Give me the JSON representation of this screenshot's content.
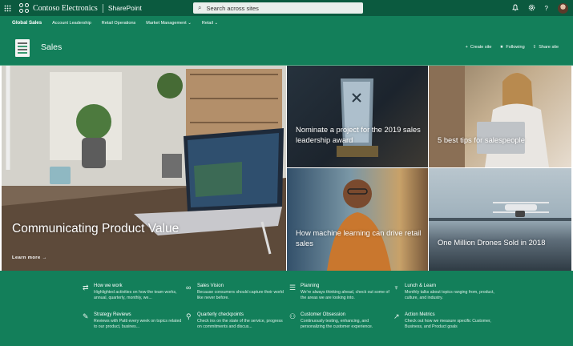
{
  "suite": {
    "brand": "Contoso Electronics",
    "app": "SharePoint",
    "search_placeholder": "Search across sites",
    "icons": [
      "waffle-icon",
      "bell-icon",
      "gear-icon",
      "help-icon"
    ],
    "colors": {
      "top": "#0b5a3f",
      "theme": "#137f5a"
    }
  },
  "nav": {
    "site": "Global Sales",
    "items": [
      {
        "label": "Account Leadership"
      },
      {
        "label": "Retail Operations"
      },
      {
        "label": "Market Management"
      },
      {
        "label": "Retail"
      }
    ]
  },
  "header": {
    "title": "Sales",
    "actions": [
      {
        "label": "Create site",
        "icon": "plus-icon"
      },
      {
        "label": "Following",
        "icon": "star-icon"
      },
      {
        "label": "Share site",
        "icon": "share-icon"
      }
    ]
  },
  "hero": {
    "main": {
      "title": "Communicating Product Value",
      "link": "Learn more"
    },
    "tiles": [
      {
        "title": "Nominate a project for the 2019 sales leadership award"
      },
      {
        "title": "5 best tips for salespeople"
      },
      {
        "title": "How machine learning can drive retail sales"
      },
      {
        "title": "One Million Drones Sold in 2018"
      }
    ],
    "trophy_text": "SALES LEADERSHIP AWARD 2019"
  },
  "quick_links": [
    {
      "title": "How we work",
      "desc": "Highlighted activities on how the team works, annual, quarterly, monthly, we...",
      "icon": "workflow-icon"
    },
    {
      "title": "Sales Vision",
      "desc": "Because consumers should capture their world like never before.",
      "icon": "glasses-icon"
    },
    {
      "title": "Planning",
      "desc": "We're always thinking ahead, check out some of the areas we are looking into.",
      "icon": "planning-icon"
    },
    {
      "title": "Lunch & Learn",
      "desc": "Monthly talks about topics ranging from, product, culture, and industry.",
      "icon": "lunch-icon"
    },
    {
      "title": "Strategy Reviews",
      "desc": "Reviews with Patti every week on topics related to our product, busines...",
      "icon": "review-icon"
    },
    {
      "title": "Quarterly checkpoints",
      "desc": "Check ins on the state of the service, progress on commitments and discus...",
      "icon": "checkpoint-icon"
    },
    {
      "title": "Customer Obsession",
      "desc": "Continuously testing, enhancing, and personalizing the customer experience.",
      "icon": "customer-icon"
    },
    {
      "title": "Action Metrics",
      "desc": "Check out how we measure specific Customer, Business, and Product goals",
      "icon": "metrics-icon"
    }
  ]
}
